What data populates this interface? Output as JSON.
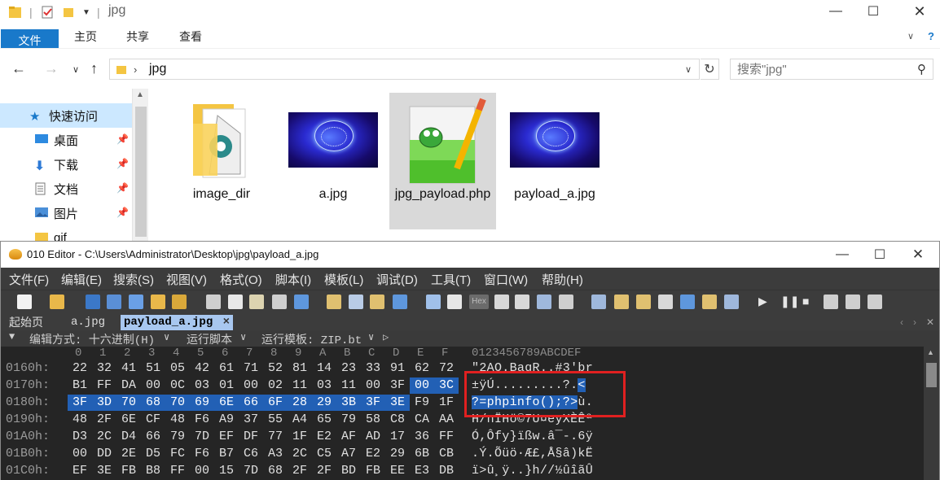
{
  "explorer": {
    "title": "jpg",
    "ribbon_tabs": [
      "文件",
      "主页",
      "共享",
      "查看"
    ],
    "address": {
      "segments": [
        "jpg"
      ]
    },
    "search": {
      "placeholder": "搜索\"jpg\""
    },
    "nav": {
      "quick_access": "快速访问",
      "items": [
        {
          "label": "桌面",
          "icon": "desktop-icon",
          "pinned": true
        },
        {
          "label": "下载",
          "icon": "download-icon",
          "pinned": true
        },
        {
          "label": "文档",
          "icon": "documents-icon",
          "pinned": true
        },
        {
          "label": "图片",
          "icon": "pictures-icon",
          "pinned": true
        },
        {
          "label": "gif",
          "icon": "folder-icon",
          "pinned": false
        }
      ]
    },
    "files": [
      {
        "name": "image_dir",
        "type": "folder",
        "icon": "folder-icon"
      },
      {
        "name": "a.jpg",
        "type": "image",
        "icon": "image-thumbnail"
      },
      {
        "name": "jpg_payload.php",
        "type": "php",
        "icon": "notepad-plus-plus-icon",
        "selected": true
      },
      {
        "name": "payload_a.jpg",
        "type": "image",
        "icon": "image-thumbnail"
      }
    ]
  },
  "editor": {
    "title": "010 Editor - C:\\Users\\Administrator\\Desktop\\jpg\\payload_a.jpg",
    "menu": [
      "文件(F)",
      "编辑(E)",
      "搜索(S)",
      "视图(V)",
      "格式(O)",
      "脚本(I)",
      "模板(L)",
      "调试(D)",
      "工具(T)",
      "窗口(W)",
      "帮助(H)"
    ],
    "tabs": [
      {
        "label": "起始页",
        "active": false
      },
      {
        "label": "a.jpg",
        "active": false
      },
      {
        "label": "payload_a.jpg",
        "active": true
      }
    ],
    "tab_close": "×",
    "options": {
      "edit_mode": "编辑方式: 十六进制(H)",
      "run_script": "运行脚本",
      "run_template": "运行模板: ZIP.bt"
    },
    "hex_columns": [
      "0",
      "1",
      "2",
      "3",
      "4",
      "5",
      "6",
      "7",
      "8",
      "9",
      "A",
      "B",
      "C",
      "D",
      "E",
      "F"
    ],
    "ascii_header": "0123456789ABCDEF",
    "rows": [
      {
        "addr": "0160h:",
        "bytes": [
          "22",
          "32",
          "41",
          "51",
          "05",
          "42",
          "61",
          "71",
          "52",
          "81",
          "14",
          "23",
          "33",
          "91",
          "62",
          "72"
        ],
        "ascii": "\"2AQ.BaqR..#3'br",
        "sel": []
      },
      {
        "addr": "0170h:",
        "bytes": [
          "B1",
          "FF",
          "DA",
          "00",
          "0C",
          "03",
          "01",
          "00",
          "02",
          "11",
          "03",
          "11",
          "00",
          "3F",
          "00",
          "3C"
        ],
        "ascii": "±ÿÚ.........?.<",
        "sel": [
          14,
          15
        ]
      },
      {
        "addr": "0180h:",
        "bytes": [
          "3F",
          "3D",
          "70",
          "68",
          "70",
          "69",
          "6E",
          "66",
          "6F",
          "28",
          "29",
          "3B",
          "3F",
          "3E",
          "F9",
          "1F"
        ],
        "ascii": "?=phpinfo();?>ù.",
        "sel": [
          0,
          1,
          2,
          3,
          4,
          5,
          6,
          7,
          8,
          9,
          10,
          11,
          12,
          13
        ]
      },
      {
        "addr": "0190h:",
        "bytes": [
          "48",
          "2F",
          "6E",
          "CF",
          "48",
          "F6",
          "A9",
          "37",
          "55",
          "A4",
          "65",
          "79",
          "58",
          "C8",
          "CA",
          "AA"
        ],
        "ascii": "H/nÏHö©7U¤eyXÈÊª",
        "sel": []
      },
      {
        "addr": "01A0h:",
        "bytes": [
          "D3",
          "2C",
          "D4",
          "66",
          "79",
          "7D",
          "EF",
          "DF",
          "77",
          "1F",
          "E2",
          "AF",
          "AD",
          "17",
          "36",
          "FF"
        ],
        "ascii": "Ó,Ôfy}ïßw.â¯-.6ÿ",
        "sel": []
      },
      {
        "addr": "01B0h:",
        "bytes": [
          "00",
          "DD",
          "2E",
          "D5",
          "FC",
          "F6",
          "B7",
          "C6",
          "A3",
          "2C",
          "C5",
          "A7",
          "E2",
          "29",
          "6B",
          "CB"
        ],
        "ascii": ".Ý.Õüö·Æ£,Å§â)kË",
        "sel": []
      },
      {
        "addr": "01C0h:",
        "bytes": [
          "EF",
          "3E",
          "FB",
          "B8",
          "FF",
          "00",
          "15",
          "7D",
          "68",
          "2F",
          "2F",
          "BD",
          "FB",
          "EE",
          "E3",
          "DB"
        ],
        "ascii": "ï>û¸ÿ..}h//½ûîãÛ",
        "sel": []
      }
    ]
  }
}
